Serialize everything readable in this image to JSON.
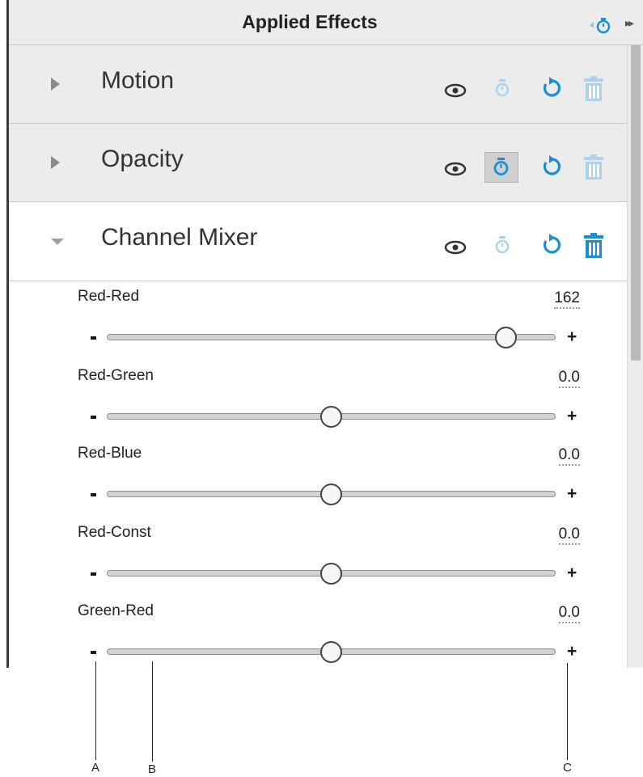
{
  "panel": {
    "title": "Applied Effects"
  },
  "effects": [
    {
      "name": "Motion",
      "state": "collapsed",
      "keyframe_active": false,
      "delete_enabled": false
    },
    {
      "name": "Opacity",
      "state": "collapsed",
      "keyframe_active": true,
      "delete_enabled": false
    },
    {
      "name": "Channel Mixer",
      "state": "expanded",
      "keyframe_active": false,
      "delete_enabled": true
    }
  ],
  "parameters": [
    {
      "label": "Red-Red",
      "value": "162",
      "level": 0.89
    },
    {
      "label": "Red-Green",
      "value": "0.0",
      "level": 0.5
    },
    {
      "label": "Red-Blue",
      "value": "0.0",
      "level": 0.5
    },
    {
      "label": "Red-Const",
      "value": "0.0",
      "level": 0.5
    },
    {
      "label": "Green-Red",
      "value": "0.0",
      "level": 0.5
    }
  ],
  "slider_symbols": {
    "minus": "-",
    "plus": "+"
  },
  "callouts": [
    "A",
    "B",
    "C"
  ],
  "icons": {
    "visibility": "eye-icon",
    "keyframe": "stopwatch-icon",
    "reset": "reset-icon",
    "delete": "trash-icon",
    "expand": "chevron-right-icon",
    "collapse": "chevron-down-icon",
    "more": "double-chevron-right-icon"
  },
  "colors": {
    "accent": "#1a8fd6",
    "accent_dim": "#a9d3ee",
    "header_bg": "#ececec",
    "row_collapsed_bg": "#ececec",
    "row_expanded_bg": "#ffffff",
    "icon_dark": "#333333"
  }
}
